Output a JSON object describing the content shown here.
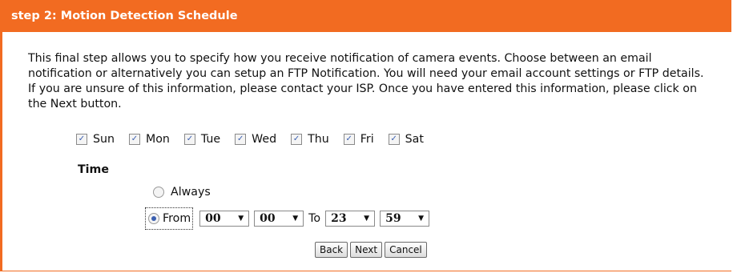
{
  "header": {
    "title": "step 2: Motion Detection Schedule"
  },
  "description": "This final step allows you to specify how you receive notification of camera events. Choose between an email notification or alternatively you can setup an FTP Notification. You will need your email account settings or FTP details. If you are unsure of this information, please contact your ISP. Once you have entered this information, please click on the Next button.",
  "days": [
    {
      "label": "Sun",
      "checked": true
    },
    {
      "label": "Mon",
      "checked": true
    },
    {
      "label": "Tue",
      "checked": true
    },
    {
      "label": "Wed",
      "checked": true
    },
    {
      "label": "Thu",
      "checked": true
    },
    {
      "label": "Fri",
      "checked": true
    },
    {
      "label": "Sat",
      "checked": true
    }
  ],
  "time": {
    "label": "Time",
    "always_label": "Always",
    "from_label": "From",
    "to_label": "To",
    "selected": "from",
    "from_hour": "00",
    "from_minute": "00",
    "to_hour": "23",
    "to_minute": "59"
  },
  "buttons": {
    "back": "Back",
    "next": "Next",
    "cancel": "Cancel"
  },
  "colors": {
    "accent": "#f26b21",
    "check": "#3b5fb0"
  },
  "icons": {
    "checkbox": "checkmark-icon",
    "dropdown": "chevron-down-icon"
  }
}
